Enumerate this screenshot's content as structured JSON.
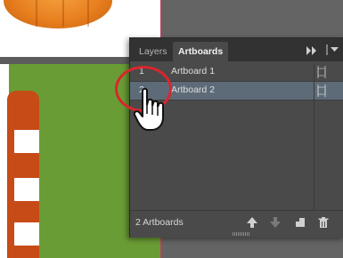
{
  "panel": {
    "tabs": [
      {
        "label": "Layers"
      },
      {
        "label": "Artboards"
      }
    ],
    "collapse_icon": "double-chevron-right-icon",
    "menu_icon": "panel-menu-icon",
    "rows": [
      {
        "number": "1",
        "name": "Artboard 1",
        "options_icon": "artboard-options-icon"
      },
      {
        "number": "2",
        "name": "Artboard 2",
        "options_icon": "artboard-options-icon",
        "selected": true
      }
    ],
    "footer": {
      "count": "2 Artboards",
      "buttons": [
        {
          "icon": "move-up-icon"
        },
        {
          "icon": "move-down-icon"
        },
        {
          "icon": "new-artboard-icon"
        },
        {
          "icon": "trash-icon"
        }
      ]
    }
  },
  "annotation": {
    "color": "#d9262e",
    "cursor_icon": "hand-pointer-icon"
  },
  "colors": {
    "selected_row": "#5d6b78",
    "panel_bg": "#4a4a4a",
    "artboard_edge": "#b8405c"
  }
}
